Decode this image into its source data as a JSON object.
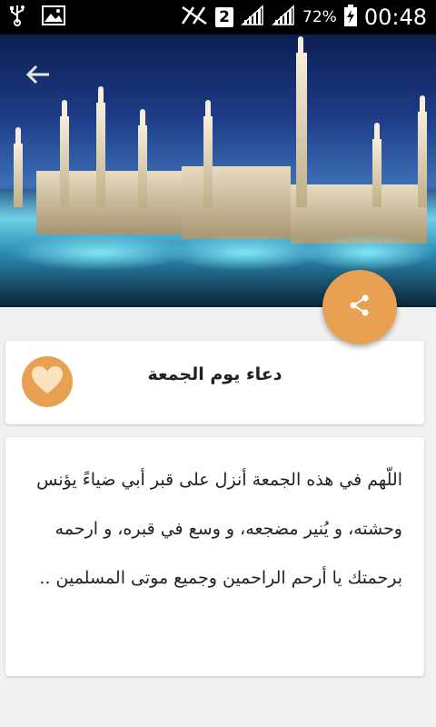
{
  "status_bar": {
    "sim_slot": "2",
    "battery_percent": "72%",
    "time": "00:48",
    "icons": [
      "usb-icon",
      "image-icon",
      "no-signal-icon",
      "signal-icon",
      "signal-icon-2",
      "battery-charging-icon"
    ]
  },
  "header": {
    "back_icon": "arrow-left-icon",
    "image_subject": "mosque-night-image"
  },
  "fab": {
    "icon": "share-icon",
    "color": "#e8a153"
  },
  "title_card": {
    "favorite_icon": "heart-icon",
    "title": "دعاء يوم الجمعة"
  },
  "body_card": {
    "text": "اللّهم في هذه الجمعة أنزل على قبر أبي ضياءً يؤنس وحشته، و يُنير مضجعه، و وسع في قبره، و ارحمه برحمتك يا أرحم الراحمين وجميع موتى المسلمين .."
  },
  "colors": {
    "accent": "#e8a153",
    "background": "#f1f1f1"
  }
}
